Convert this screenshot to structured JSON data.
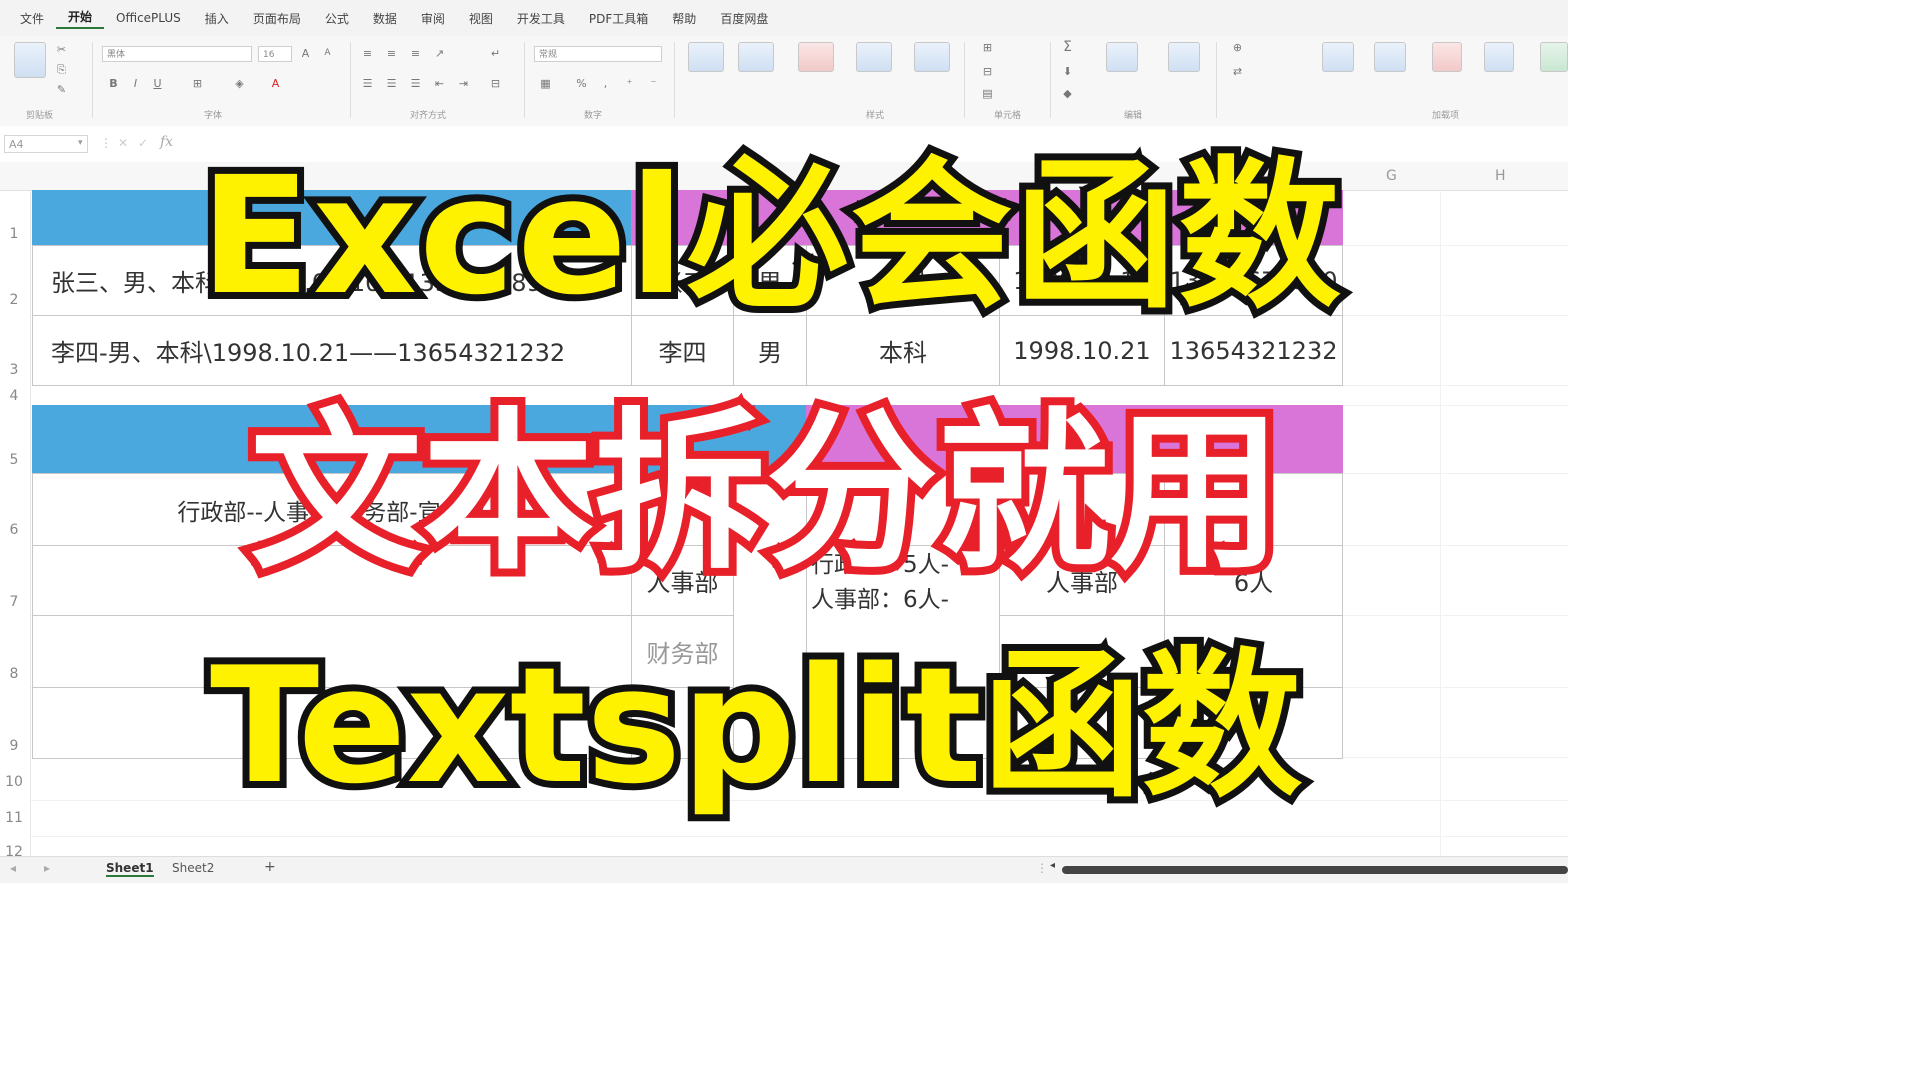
{
  "menu": {
    "items": [
      "文件",
      "开始",
      "OfficePLUS",
      "插入",
      "页面布局",
      "公式",
      "数据",
      "审阅",
      "视图",
      "开发工具",
      "PDF工具箱",
      "帮助",
      "百度网盘"
    ],
    "active": "开始"
  },
  "ribbon": {
    "font_name": "黑体",
    "font_size": "16",
    "number_format": "常规",
    "bold": "B",
    "italic": "I",
    "underline": "U",
    "autosum": "Σ",
    "groups": [
      "剪贴板",
      "字体",
      "对齐方式",
      "数字",
      "样式",
      "单元格",
      "编辑",
      "加载项"
    ]
  },
  "formula_bar": {
    "name_box": "A4",
    "fx": "fx"
  },
  "columns": [
    "G",
    "H"
  ],
  "rows": [
    "1",
    "2",
    "3",
    "4",
    "5",
    "6",
    "7",
    "8",
    "9",
    "10",
    "11",
    "12"
  ],
  "table1": {
    "row2": {
      "source": "张三、男、本科、1999.02.10、13345678910",
      "name": "张三",
      "gender": "男",
      "degree": "本科",
      "date": "1999.02.10",
      "phone": "13345678910"
    },
    "row3": {
      "source": "李四-男、本科\\1998.10.21——13654321232",
      "name": "李四",
      "gender": "男",
      "degree": "本科",
      "date": "1998.10.21",
      "phone": "13654321232"
    }
  },
  "table2": {
    "row6_source": "行政部--人事部-财务部-宣传部",
    "dept_col": [
      "人事部",
      "财务部"
    ],
    "multi_lines": [
      "行政部：5人-",
      "人事部：6人-"
    ],
    "row7_dept": "人事部",
    "row7_count": "6人"
  },
  "overlay": {
    "line1": "Excel必会函数",
    "line2": "文本拆分就用",
    "line3": "Textsplit函数"
  },
  "sheet_tabs": {
    "sheets": [
      "Sheet1",
      "Sheet2"
    ],
    "active": "Sheet1",
    "add": "+"
  },
  "colors": {
    "header_blue": "#4aa8de",
    "header_pink": "#d974d9",
    "title_yellow": "#fff200",
    "title_red_stroke": "#e8202a"
  }
}
